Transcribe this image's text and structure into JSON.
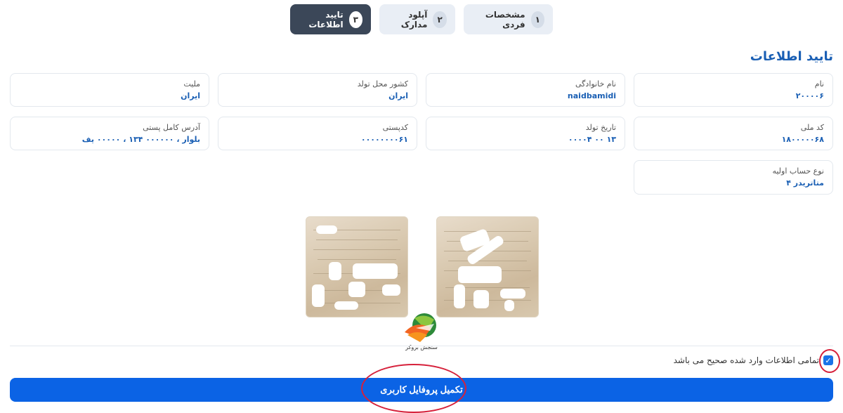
{
  "stepper": {
    "steps": [
      {
        "num": "۱",
        "label": "مشخصات فردی"
      },
      {
        "num": "۲",
        "label": "آپلود مدارک"
      },
      {
        "num": "۳",
        "label": "تایید اطلاعات"
      }
    ],
    "active_step": 3
  },
  "section": {
    "title": "تایید اطلاعات"
  },
  "fields": {
    "first_name": {
      "label": "نام",
      "value": "۲۰۰۰۰۶"
    },
    "last_name": {
      "label": "نام خانوادگی",
      "value": "naidbamidi"
    },
    "birth_country": {
      "label": "کشور محل تولد",
      "value": "ایران"
    },
    "nationality": {
      "label": "ملیت",
      "value": "ایران"
    },
    "national_code": {
      "label": "کد ملی",
      "value": "۱۸۰۰۰۰۰۶۸"
    },
    "birth_date": {
      "label": "تاریخ تولد",
      "value": "۱۳ ۰۰ ۰۰۰۰۴"
    },
    "postal_code": {
      "label": "کدپستی",
      "value": "۰۰۰۰۰۰۰۰۶۱"
    },
    "address": {
      "label": "آدرس کامل پستی",
      "value": "بلوار ، ۰۰۰۰۰۰ ۱۳۴ ، ۰۰۰۰۰ یف"
    },
    "account_type": {
      "label": "نوع حساب اولیه",
      "value": "متاتریدر ۴"
    }
  },
  "watermark": {
    "text": "سنجش بروکر"
  },
  "confirm": {
    "text": "تمامی اطلاعات وارد شده صحیح می باشد",
    "checked": true
  },
  "submit": {
    "label": "تکمیل پروفایل کاربری"
  },
  "colors": {
    "primary": "#0b63e5",
    "title": "#1a5fb4",
    "annotation": "#d6213b",
    "active_step": "#3b4758"
  }
}
